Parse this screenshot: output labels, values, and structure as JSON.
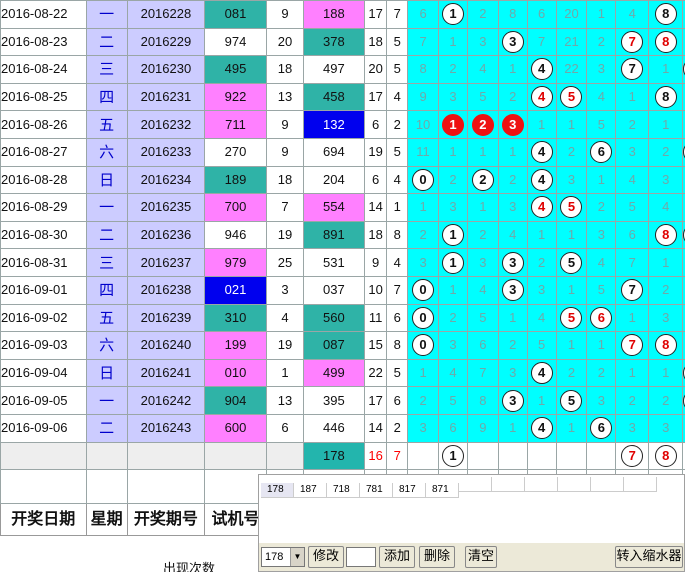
{
  "rows": [
    {
      "date": "2016-08-22",
      "wk": "一",
      "period": "2016228",
      "test": "081",
      "a": "9",
      "sum": "188",
      "b": "17",
      "c": "7",
      "cells": [
        "6",
        "@1",
        "2",
        "8",
        "6",
        "20",
        "1",
        "4",
        "@8",
        "1"
      ],
      "testc": "teal",
      "sumc": "pink"
    },
    {
      "date": "2016-08-23",
      "wk": "二",
      "period": "2016229",
      "test": "974",
      "a": "20",
      "sum": "378",
      "b": "18",
      "c": "5",
      "cells": [
        "7",
        "1",
        "3",
        "@3",
        "7",
        "21",
        "2",
        "R7",
        "R8",
        "2"
      ],
      "testc": "per",
      "sumc": "teal"
    },
    {
      "date": "2016-08-24",
      "wk": "三",
      "period": "2016230",
      "test": "495",
      "a": "18",
      "sum": "497",
      "b": "20",
      "c": "5",
      "cells": [
        "8",
        "2",
        "4",
        "1",
        "@4",
        "22",
        "3",
        "@7",
        "1",
        "@9"
      ],
      "testc": "teal",
      "sumc": "per"
    },
    {
      "date": "2016-08-25",
      "wk": "四",
      "period": "2016231",
      "test": "922",
      "a": "13",
      "sum": "458",
      "b": "17",
      "c": "4",
      "cells": [
        "9",
        "3",
        "5",
        "2",
        "R4",
        "R5",
        "4",
        "1",
        "@8",
        "1"
      ],
      "testc": "pink",
      "sumc": "teal"
    },
    {
      "date": "2016-08-26",
      "wk": "五",
      "period": "2016232",
      "test": "711",
      "a": "9",
      "sum": "132",
      "b": "6",
      "c": "2",
      "cells": [
        "10",
        "F1",
        "F2",
        "F3",
        "1",
        "1",
        "5",
        "2",
        "1",
        "2"
      ],
      "testc": "pink",
      "sumc": "bluew"
    },
    {
      "date": "2016-08-27",
      "wk": "六",
      "period": "2016233",
      "test": "270",
      "a": "9",
      "sum": "694",
      "b": "19",
      "c": "5",
      "cells": [
        "11",
        "1",
        "1",
        "1",
        "@4",
        "2",
        "@6",
        "3",
        "2",
        "@9"
      ],
      "testc": "per",
      "sumc": "per"
    },
    {
      "date": "2016-08-28",
      "wk": "日",
      "period": "2016234",
      "test": "189",
      "a": "18",
      "sum": "204",
      "b": "6",
      "c": "4",
      "cells": [
        "@0",
        "2",
        "@2",
        "2",
        "@4",
        "3",
        "1",
        "4",
        "3",
        "1"
      ],
      "testc": "teal",
      "sumc": "per"
    },
    {
      "date": "2016-08-29",
      "wk": "一",
      "period": "2016235",
      "test": "700",
      "a": "7",
      "sum": "554",
      "b": "14",
      "c": "1",
      "cells": [
        "1",
        "3",
        "1",
        "3",
        "R4",
        "R5",
        "2",
        "5",
        "4",
        "2"
      ],
      "testc": "pink",
      "sumc": "pink"
    },
    {
      "date": "2016-08-30",
      "wk": "二",
      "period": "2016236",
      "test": "946",
      "a": "19",
      "sum": "891",
      "b": "18",
      "c": "8",
      "cells": [
        "2",
        "@1",
        "2",
        "4",
        "1",
        "1",
        "3",
        "6",
        "R8",
        "R9"
      ],
      "testc": "per",
      "sumc": "teal"
    },
    {
      "date": "2016-08-31",
      "wk": "三",
      "period": "2016237",
      "test": "979",
      "a": "25",
      "sum": "531",
      "b": "9",
      "c": "4",
      "cells": [
        "3",
        "@1",
        "3",
        "@3",
        "2",
        "@5",
        "4",
        "7",
        "1",
        "1"
      ],
      "testc": "pink",
      "sumc": "per"
    },
    {
      "date": "2016-09-01",
      "wk": "四",
      "period": "2016238",
      "test": "021",
      "a": "3",
      "sum": "037",
      "b": "10",
      "c": "7",
      "cells": [
        "@0",
        "1",
        "4",
        "@3",
        "3",
        "1",
        "5",
        "@7",
        "2",
        "2"
      ],
      "testc": "bluew",
      "sumc": "per"
    },
    {
      "date": "2016-09-02",
      "wk": "五",
      "period": "2016239",
      "test": "310",
      "a": "4",
      "sum": "560",
      "b": "11",
      "c": "6",
      "cells": [
        "@0",
        "2",
        "5",
        "1",
        "4",
        "R5",
        "R6",
        "1",
        "3",
        "3"
      ],
      "testc": "teal",
      "sumc": "teal"
    },
    {
      "date": "2016-09-03",
      "wk": "六",
      "period": "2016240",
      "test": "199",
      "a": "19",
      "sum": "087",
      "b": "15",
      "c": "8",
      "cells": [
        "@0",
        "3",
        "6",
        "2",
        "5",
        "1",
        "1",
        "R7",
        "R8",
        "4"
      ],
      "testc": "pink",
      "sumc": "teal"
    },
    {
      "date": "2016-09-04",
      "wk": "日",
      "period": "2016241",
      "test": "010",
      "a": "1",
      "sum": "499",
      "b": "22",
      "c": "5",
      "cells": [
        "1",
        "4",
        "7",
        "3",
        "@4",
        "2",
        "2",
        "1",
        "1",
        "@9"
      ],
      "testc": "pink",
      "sumc": "pink"
    },
    {
      "date": "2016-09-05",
      "wk": "一",
      "period": "2016242",
      "test": "904",
      "a": "13",
      "sum": "395",
      "b": "17",
      "c": "6",
      "cells": [
        "2",
        "5",
        "8",
        "@3",
        "1",
        "@5",
        "3",
        "2",
        "2",
        "@9"
      ],
      "testc": "teal",
      "sumc": "per"
    },
    {
      "date": "2016-09-06",
      "wk": "二",
      "period": "2016243",
      "test": "600",
      "a": "6",
      "sum": "446",
      "b": "14",
      "c": "2",
      "cells": [
        "3",
        "6",
        "9",
        "1",
        "@4",
        "1",
        "@6",
        "3",
        "3",
        "1"
      ],
      "testc": "pink",
      "sumc": "per"
    }
  ],
  "footer": {
    "sum": "178",
    "b": "16",
    "c": "7",
    "cells": [
      "",
      "@1",
      "",
      "",
      "",
      "",
      "",
      "R7",
      "R8",
      ""
    ]
  },
  "headers": {
    "date": "开奖日期",
    "week": "星期",
    "period": "开奖期号",
    "test": "试机号"
  },
  "subnote": "出现次数",
  "panel": {
    "list": [
      "178",
      "187",
      "718",
      "781",
      "817",
      "871"
    ],
    "select_value": "178",
    "buttons": {
      "edit": "修改",
      "add": "添加",
      "delete": "删除",
      "clear": "清空",
      "shrink": "转入缩水器"
    }
  },
  "colors": {
    "cyan": "#00ffff",
    "pink": "#ff80ff",
    "teal": "#2fb3a7",
    "blue": "#0000ee",
    "red": "#ff0000"
  }
}
